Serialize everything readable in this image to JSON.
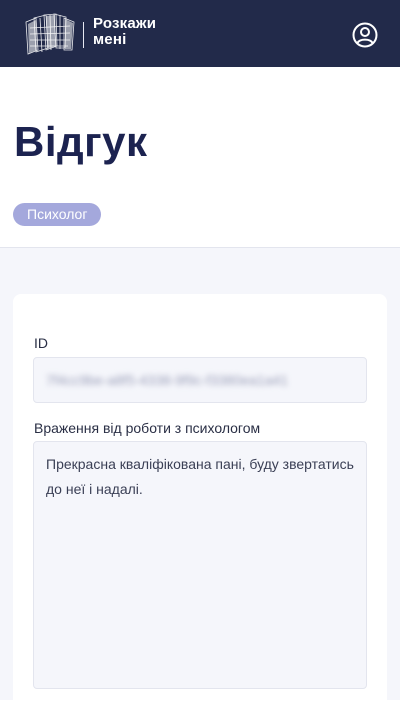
{
  "header": {
    "logo_line1": "Розкажи",
    "logo_line2": "мені",
    "logo_icon": "logo-mark-icon",
    "profile_icon": "user-circle-icon",
    "background": "#222a4a"
  },
  "page": {
    "title": "Відгук",
    "tag": "Психолог"
  },
  "form": {
    "id_label": "ID",
    "id_value": "7f4cc9be-a8f5-4338-9f9c-f3380ea1a41",
    "impression_label": "Враження від роботи з психологом",
    "impression_value": "Прекрасна кваліфікована пані, буду звертатись до неї і надалі."
  },
  "colors": {
    "accent": "#1c2350",
    "tag_bg": "#a4a8dc",
    "field_bg": "#f5f6fb"
  }
}
